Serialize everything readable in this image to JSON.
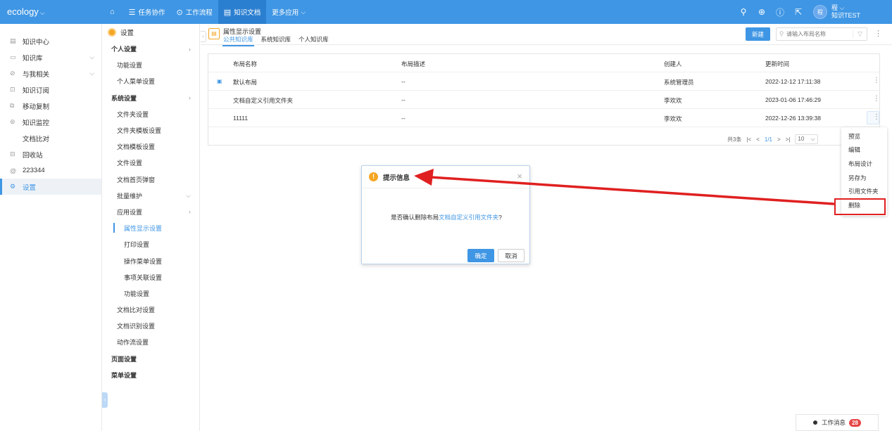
{
  "topbar": {
    "logo": "ecology",
    "nav": [
      {
        "icon": "home-icon",
        "label": ""
      },
      {
        "icon": "list-icon",
        "label": "任务协作"
      },
      {
        "icon": "flow-icon",
        "label": "工作流程"
      },
      {
        "icon": "doc-icon",
        "label": "知识文档"
      },
      {
        "icon": "",
        "label": "更多应用"
      }
    ],
    "user_avatar": "程",
    "user_name": "程",
    "user_org": "知识TEST"
  },
  "leftnav": {
    "items": [
      {
        "label": "知识中心",
        "icon": "doc-icon"
      },
      {
        "label": "知识库",
        "icon": "book-icon"
      },
      {
        "label": "与我相关",
        "icon": "link-icon"
      },
      {
        "label": "知识订阅",
        "icon": "subscribe-icon"
      },
      {
        "label": "移动复制",
        "icon": "copy-icon"
      },
      {
        "label": "知识监控",
        "icon": "monitor-icon"
      },
      {
        "label": "文档比对",
        "icon": ""
      },
      {
        "label": "回收站",
        "icon": "trash-icon"
      },
      {
        "label": "223344",
        "icon": "at-icon"
      },
      {
        "label": "设置",
        "icon": "settings-icon"
      }
    ]
  },
  "subnav": {
    "title": "设置",
    "rows": [
      {
        "label": "个人设置"
      },
      {
        "label": "功能设置"
      },
      {
        "label": "个人菜单设置"
      },
      {
        "label": "系统设置"
      },
      {
        "label": "文件夹设置"
      },
      {
        "label": "文件夹模板设置"
      },
      {
        "label": "文档模板设置"
      },
      {
        "label": "文件设置"
      },
      {
        "label": "文档首页弹窗"
      },
      {
        "label": "批量维护"
      },
      {
        "label": "应用设置"
      },
      {
        "label": "属性显示设置"
      },
      {
        "label": "打印设置"
      },
      {
        "label": "操作菜单设置"
      },
      {
        "label": "事项关联设置"
      },
      {
        "label": "功能设置"
      },
      {
        "label": "文档比对设置"
      },
      {
        "label": "文档识别设置"
      },
      {
        "label": "动作流设置"
      },
      {
        "label": "页面设置"
      },
      {
        "label": "菜单设置"
      }
    ]
  },
  "main": {
    "page_title": "属性显示设置",
    "tabs": [
      "公共知识库",
      "系统知识库",
      "个人知识库"
    ],
    "new_button": "新建",
    "search_placeholder": "请输入布局名称",
    "table": {
      "headers": [
        "布局名称",
        "布局描述",
        "创建人",
        "更新时间"
      ],
      "rows": [
        {
          "name": "默认布局",
          "desc": "--",
          "creator": "系统管理员",
          "time": "2022-12-12 17:11:38"
        },
        {
          "name": "文档自定义引用文件夹",
          "desc": "--",
          "creator": "李欢欢",
          "time": "2023-01-06 17:46:29"
        },
        {
          "name": "11111",
          "desc": "--",
          "creator": "李欢欢",
          "time": "2022-12-26 13:39:38"
        }
      ]
    },
    "pager": {
      "total": "共3条",
      "page": "1/1",
      "size": "10"
    }
  },
  "menu": {
    "items": [
      "预览",
      "编辑",
      "布局设计",
      "另存为",
      "引用文件夹",
      "删除"
    ]
  },
  "modal": {
    "title": "提示信息",
    "body_prefix": "是否确认删除布局",
    "body_link": "文档自定义引用文件夹",
    "body_suffix": "?",
    "ok": "确定",
    "cancel": "取消"
  },
  "msgbar": {
    "label": "工作消息",
    "count": "28"
  },
  "colors": {
    "primary": "#3f96e4",
    "annotation": "#e02020",
    "warning": "#f5a623"
  }
}
